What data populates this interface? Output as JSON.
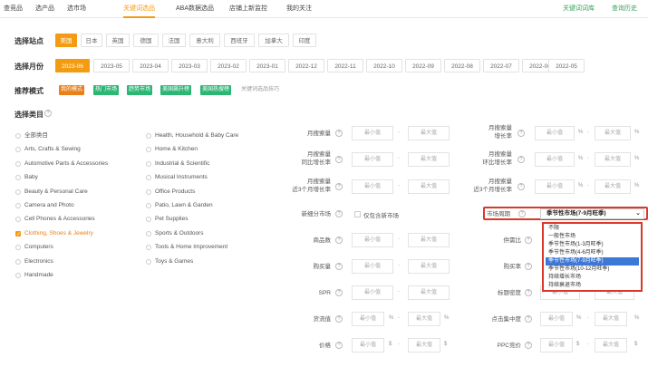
{
  "topnav": {
    "tabs": [
      "查竞品",
      "选产品",
      "选市场",
      "关键词选品",
      "ABA数据选品",
      "店铺上新监控",
      "我的关注"
    ],
    "active_index": 3,
    "right_links": [
      "关键词词库",
      "查询历史"
    ]
  },
  "site": {
    "label": "选择站点",
    "options": [
      "美国",
      "日本",
      "英国",
      "德国",
      "法国",
      "意大利",
      "西班牙",
      "加拿大",
      "印度"
    ],
    "selected": 0
  },
  "month": {
    "label": "选择月份",
    "options": [
      "2023-06",
      "2023-05",
      "2023-04",
      "2023-03",
      "2023-02",
      "2023-01",
      "2022-12",
      "2022-11",
      "2022-10",
      "2022-09",
      "2022-08",
      "2022-07",
      "2022-06",
      "2022-05"
    ],
    "selected": 0
  },
  "mode": {
    "label": "推荐模式",
    "tags": [
      "我的模式",
      "热门市场",
      "趋势市场",
      "美国飙升榜",
      "美国热搜榜",
      "关键词选品技巧"
    ]
  },
  "category": {
    "label": "选择类目",
    "col1": [
      "全部类目",
      "Arts, Crafts & Sewing",
      "Automotive Parts & Accessories",
      "Baby",
      "Beauty & Personal Care",
      "Camera and Photo",
      "Cell Phones & Accessories",
      "Clothing, Shoes & Jewelry",
      "Computers",
      "Electronics",
      "Handmade"
    ],
    "col2": [
      "Health, Household & Baby Care",
      "Home & Kitchen",
      "Industrial & Scientific",
      "Musical Instruments",
      "Office Products",
      "Patio, Lawn & Garden",
      "Pet Supplies",
      "Sports & Outdoors",
      "Tools & Home Improvement",
      "Toys & Games"
    ],
    "checked": "Clothing, Shoes & Jewelry"
  },
  "filters": {
    "min_placeholder": "最小值",
    "max_placeholder": "最大值",
    "percent": "%",
    "dollar": "$",
    "left": [
      [
        "月搜索量"
      ],
      [
        "月搜索量",
        "同比增长率"
      ],
      [
        "月搜索量",
        "近3个月增长率"
      ],
      [
        "新细分市场"
      ],
      [
        "商品数"
      ],
      [
        "购买量"
      ],
      [
        "SPR"
      ],
      [
        "货流值"
      ],
      [
        "价格"
      ]
    ],
    "new_market_checkbox": "仅包含新市场",
    "right": [
      [
        "月搜索量",
        "增长率"
      ],
      [
        "月搜索量",
        "环比增长率"
      ],
      [
        "月搜索量",
        "近3个月增长率"
      ],
      [
        "市场周期"
      ],
      [
        "供需比"
      ],
      [
        "购买率"
      ],
      [
        "标题密度"
      ],
      [
        "点击集中度"
      ],
      [
        "PPC竞价"
      ]
    ]
  },
  "market_cycle": {
    "selected": "季节性市场(7-9月旺季)",
    "options": [
      "不限",
      "一般性市场",
      "季节性市场(1-3月旺季)",
      "季节性市场(4-6月旺季)",
      "季节性市场(7-9月旺季)",
      "季节性市场(10-12月旺季)",
      "持续增长市场",
      "持续衰退市场"
    ],
    "selected_index": 4
  }
}
